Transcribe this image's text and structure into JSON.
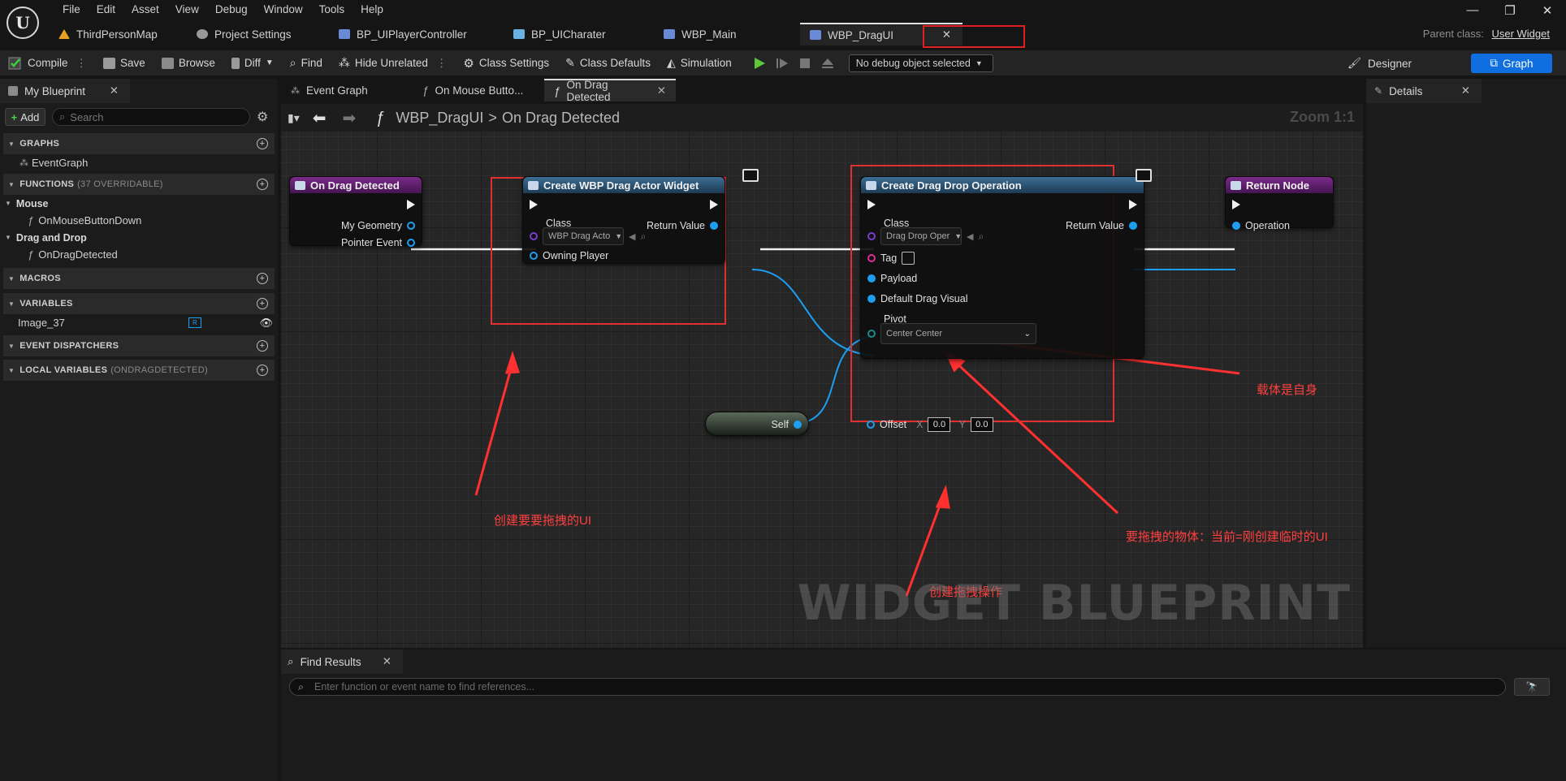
{
  "menu": [
    "File",
    "Edit",
    "Asset",
    "View",
    "Debug",
    "Window",
    "Tools",
    "Help"
  ],
  "doc_tabs": [
    {
      "label": "ThirdPersonMap",
      "color": "#e8a020"
    },
    {
      "label": "Project Settings",
      "color": "#aaaaaa"
    },
    {
      "label": "BP_UIPlayerController",
      "color": "#6a8ad8"
    },
    {
      "label": "BP_UICharater",
      "color": "#6ab0e0"
    },
    {
      "label": "WBP_Main",
      "color": "#6a8ad8"
    },
    {
      "label": "WBP_DragUI",
      "color": "#6a8ad8"
    }
  ],
  "parent_class": {
    "label": "Parent class:",
    "value": "User Widget"
  },
  "toolbar": {
    "compile": "Compile",
    "save": "Save",
    "browse": "Browse",
    "diff": "Diff",
    "find": "Find",
    "hide_unrelated": "Hide Unrelated",
    "class_settings": "Class Settings",
    "class_defaults": "Class Defaults",
    "simulation": "Simulation",
    "debug_object": "No debug object selected",
    "designer": "Designer",
    "graph": "Graph"
  },
  "my_blueprint": {
    "tab": "My Blueprint",
    "add": "Add",
    "search_placeholder": "Search",
    "graphs_header": "GRAPHS",
    "graph_items": [
      "EventGraph"
    ],
    "functions_header": "FUNCTIONS",
    "functions_sub": "(37 OVERRIDABLE)",
    "mouse_cat": "Mouse",
    "mouse_items": [
      "OnMouseButtonDown"
    ],
    "drag_cat": "Drag and Drop",
    "drag_items": [
      "OnDragDetected"
    ],
    "macros_header": "MACROS",
    "variables_header": "VARIABLES",
    "variables": [
      "Image_37"
    ],
    "dispatchers_header": "EVENT DISPATCHERS",
    "local_vars_header": "LOCAL VARIABLES",
    "local_vars_sub": "(ONDRAGDETECTED)"
  },
  "graph_tabs": [
    {
      "label": "Event Graph",
      "closable": false
    },
    {
      "label": "On Mouse Butto...",
      "closable": false
    },
    {
      "label": "On Drag Detected",
      "closable": true
    }
  ],
  "breadcrumb": {
    "blueprint": "WBP_DragUI",
    "sep": ">",
    "graph": "On Drag Detected",
    "zoom": "Zoom 1:1"
  },
  "nodes": {
    "on_drag": {
      "title": "On Drag Detected",
      "pins": [
        "My Geometry",
        "Pointer Event"
      ]
    },
    "create_widget": {
      "title": "Create WBP Drag Actor Widget",
      "class_label": "Class",
      "class_value": "WBP Drag Acto",
      "return": "Return Value",
      "owning": "Owning Player"
    },
    "create_op": {
      "title": "Create Drag Drop Operation",
      "class_label": "Class",
      "class_value": "Drag Drop Oper",
      "return": "Return Value",
      "tag": "Tag",
      "payload": "Payload",
      "visual": "Default Drag Visual",
      "pivot": "Pivot",
      "pivot_value": "Center Center",
      "offset": "Offset",
      "x_label": "X",
      "x_value": "0.0",
      "y_label": "Y",
      "y_value": "0.0"
    },
    "return_node": {
      "title": "Return Node",
      "operation": "Operation"
    },
    "self": {
      "label": "Self"
    }
  },
  "annotations": {
    "create_ui": "创建要要拖拽的UI",
    "create_op": "创建拖拽操作",
    "payload": "载体是自身",
    "visual": "要拖拽的物体：当前=刚创建临时的UI"
  },
  "watermark": "WIDGET BLUEPRINT",
  "details": {
    "tab": "Details"
  },
  "find_results": {
    "tab": "Find Results",
    "placeholder": "Enter function or event name to find references...",
    "button": "🔭"
  }
}
